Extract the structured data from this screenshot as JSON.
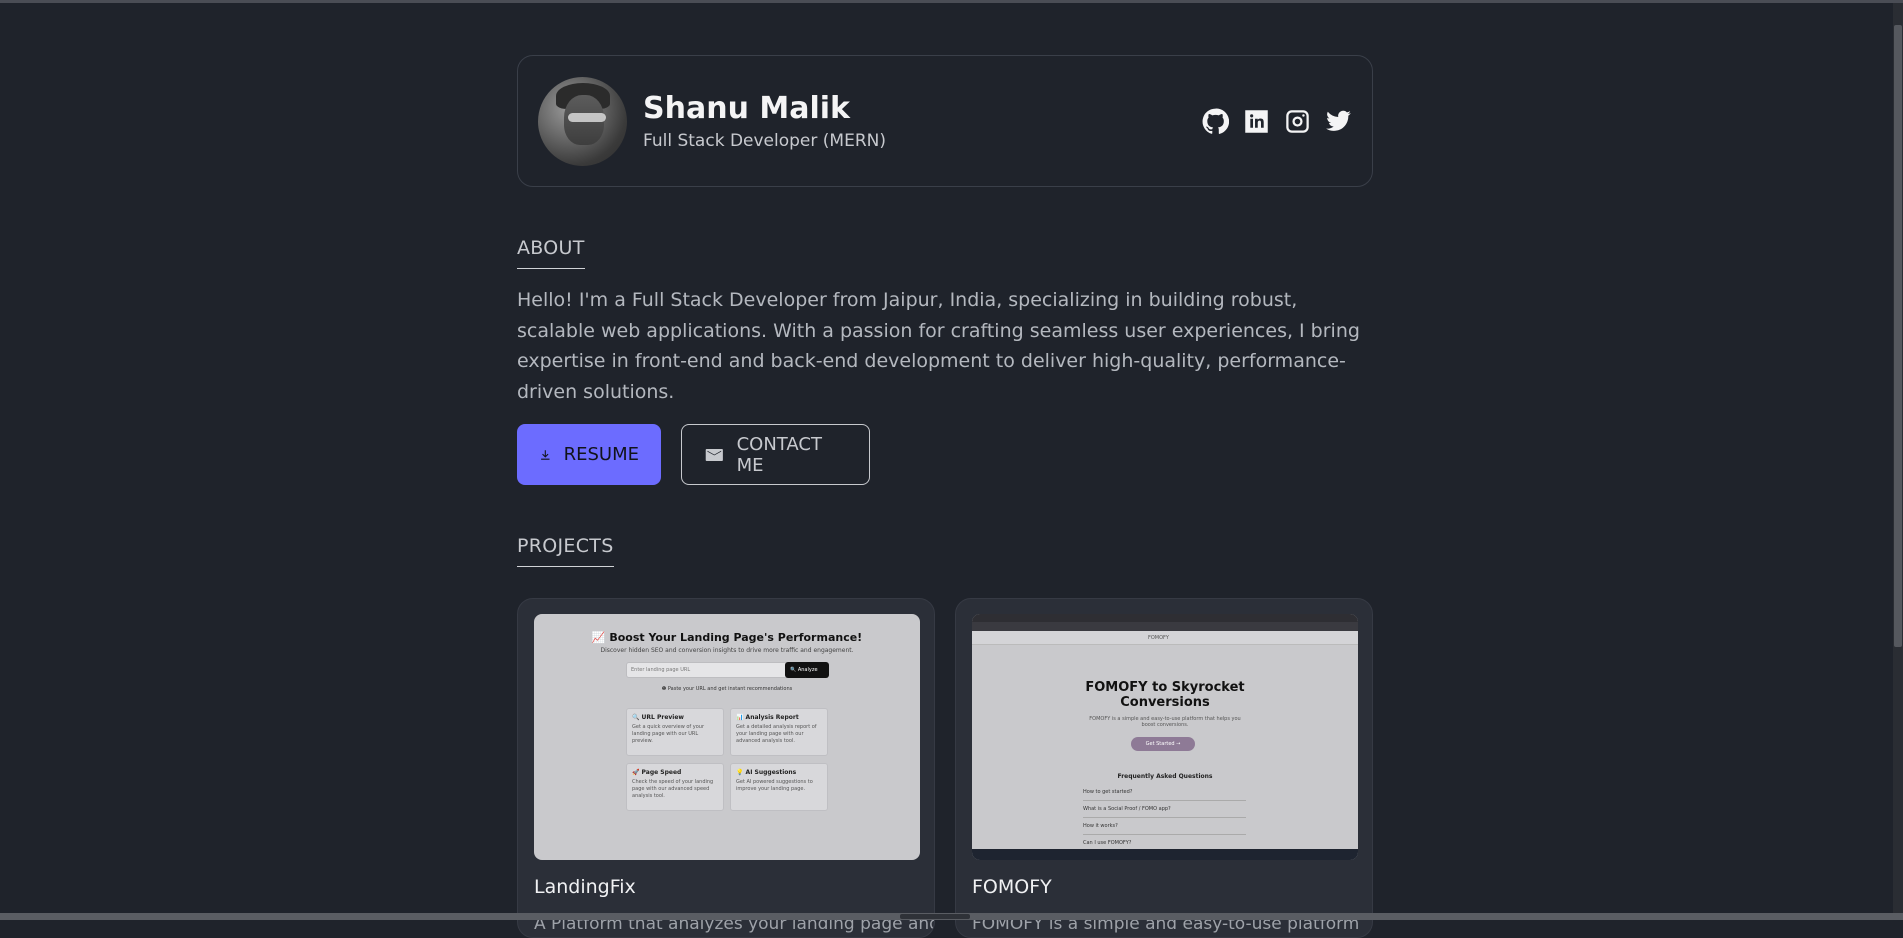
{
  "profile": {
    "name": "Shanu Malik",
    "role": "Full Stack Developer (MERN)",
    "socials": [
      {
        "name": "github-icon"
      },
      {
        "name": "linkedin-icon"
      },
      {
        "name": "instagram-icon"
      },
      {
        "name": "twitter-icon"
      }
    ]
  },
  "about": {
    "heading": "ABOUT",
    "text": "Hello! I'm a Full Stack Developer from Jaipur, India, specializing in building robust, scalable web applications. With a passion for crafting seamless user experiences, I bring expertise in front-end and back-end development to deliver high-quality, performance-driven solutions.",
    "resume_label": "RESUME",
    "contact_label": "CONTACT ME"
  },
  "projects": {
    "heading": "PROJECTS",
    "items": [
      {
        "title": "LandingFix",
        "desc": "A Platform that analyzes your landing page and",
        "shot": {
          "title": "📈 Boost Your Landing Page's Performance!",
          "subtitle": "Discover hidden SEO and conversion insights to drive more traffic and engagement.",
          "input_placeholder": "Enter landing page URL",
          "button": "🔍 Analyze",
          "hint": "❶ Paste your URL and get instant recommendations",
          "boxes": [
            {
              "title": "🔍 URL Preview",
              "text": "Get a quick overview of your landing page with our URL preview."
            },
            {
              "title": "📊 Analysis Report",
              "text": "Get a detailed analysis report of your landing page with our advanced analysis tool."
            },
            {
              "title": "🚀 Page Speed",
              "text": "Check the speed of your landing page with our advanced speed analysis tool."
            },
            {
              "title": "💡 AI Suggestions",
              "text": "Get AI powered suggestions to improve your landing page."
            }
          ]
        }
      },
      {
        "title": "FOMOFY",
        "desc": "FOMOFY is a simple and easy-to-use platform",
        "shot": {
          "brand": "FOMOFY",
          "title": "FOMOFY to Skyrocket Conversions",
          "subtitle": "FOMOFY is a simple and easy-to-use platform that helps you boost conversions.",
          "button": "Get Started →",
          "faq_heading": "Frequently Asked Questions",
          "faqs": [
            "How to get started?",
            "What is a Social Proof / FOMO app?",
            "How it works?",
            "Can I use FOMOFY?"
          ]
        }
      }
    ]
  }
}
